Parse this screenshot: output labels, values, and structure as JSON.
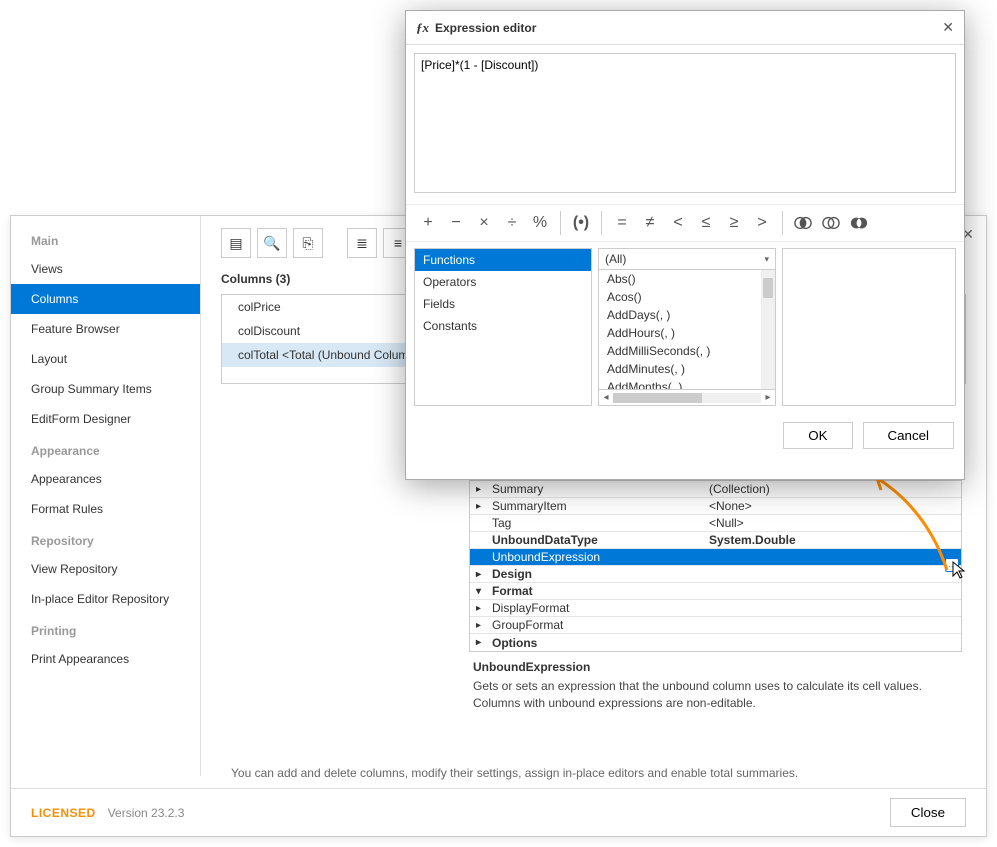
{
  "main": {
    "sidebar": {
      "headings": {
        "main": "Main",
        "appearance": "Appearance",
        "repository": "Repository",
        "printing": "Printing"
      },
      "items": {
        "views": "Views",
        "columns": "Columns",
        "feature_browser": "Feature Browser",
        "layout": "Layout",
        "group_summary": "Group Summary Items",
        "editform": "EditForm Designer",
        "appearances": "Appearances",
        "format_rules": "Format Rules",
        "view_repo": "View Repository",
        "inplace_repo": "In-place Editor Repository",
        "print_appearances": "Print Appearances"
      }
    },
    "columns_title": "Columns (3)",
    "columns": {
      "c0": "colPrice",
      "c1": "colDiscount",
      "c2": "colTotal <Total (Unbound Column)"
    },
    "props": {
      "summary": {
        "name": "Summary",
        "val": "(Collection)"
      },
      "summary_item": {
        "name": "SummaryItem",
        "val": "<None>"
      },
      "tag": {
        "name": "Tag",
        "val": "<Null>"
      },
      "unbound_type": {
        "name": "UnboundDataType",
        "val": "System.Double"
      },
      "unbound_expr": {
        "name": "UnboundExpression",
        "val": ""
      },
      "design": {
        "name": "Design"
      },
      "format": {
        "name": "Format"
      },
      "display_format": {
        "name": "DisplayFormat"
      },
      "group_format": {
        "name": "GroupFormat"
      },
      "options": {
        "name": "Options"
      }
    },
    "prop_desc": {
      "title": "UnboundExpression",
      "text": "Gets or sets an expression that the unbound column uses to calculate its cell values. Columns with unbound expressions are non-editable."
    },
    "hint": "You can add and delete columns, modify their settings, assign in-place editors and enable total summaries.",
    "footer": {
      "licensed": "LICENSED",
      "version": "Version 23.2.3",
      "close": "Close"
    }
  },
  "dialog": {
    "title": "Expression editor",
    "expression": "[Price]*(1 - [Discount])",
    "categories": {
      "functions": "Functions",
      "operators": "Operators",
      "fields": "Fields",
      "constants": "Constants"
    },
    "func_filter": "(All)",
    "functions": {
      "f0": "Abs()",
      "f1": "Acos()",
      "f2": "AddDays(, )",
      "f3": "AddHours(, )",
      "f4": "AddMilliSeconds(, )",
      "f5": "AddMinutes(, )",
      "f6": "AddMonths(, )"
    },
    "ok": "OK",
    "cancel": "Cancel"
  }
}
